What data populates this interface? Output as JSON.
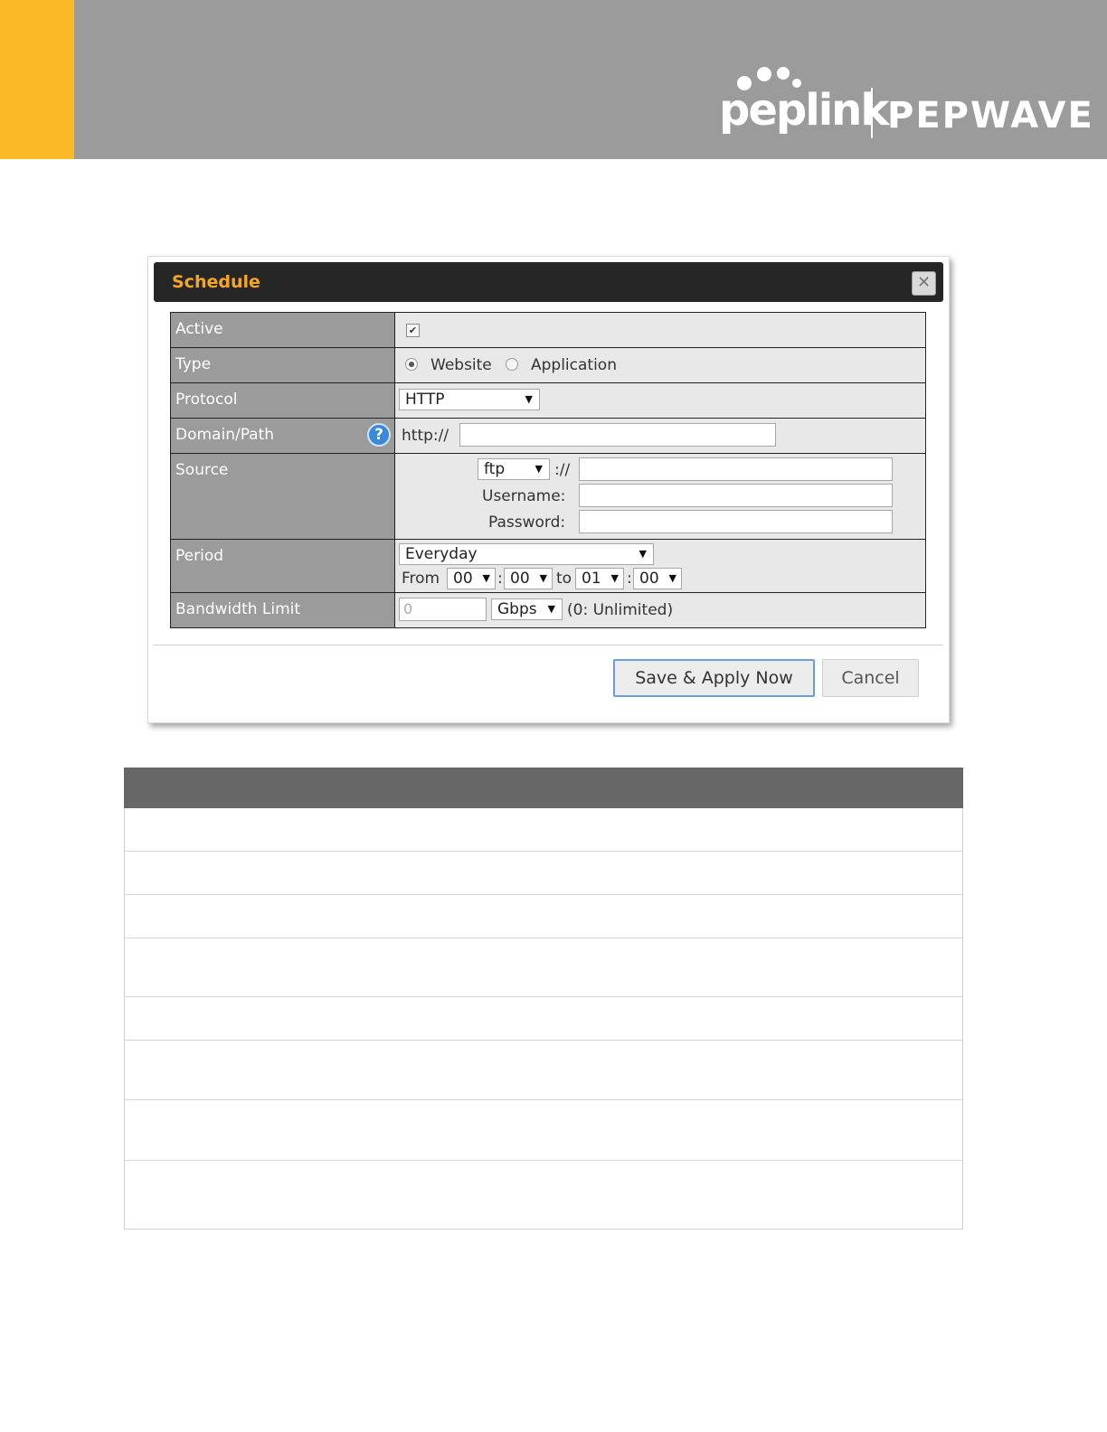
{
  "brand": {
    "logo_left": "peplink",
    "logo_right": "PEPWAVE",
    "accent_color": "#fdb827",
    "header_color": "#9b9b9b"
  },
  "dialog": {
    "title": "Schedule",
    "close_icon": "close-icon",
    "fields": {
      "active": {
        "label": "Active",
        "checked": true
      },
      "type": {
        "label": "Type",
        "options": [
          "Website",
          "Application"
        ],
        "selected": "Website"
      },
      "protocol": {
        "label": "Protocol",
        "value": "HTTP"
      },
      "domain": {
        "label": "Domain/Path",
        "prefix": "http://",
        "value": ""
      },
      "source": {
        "label": "Source",
        "scheme": "ftp",
        "separator": "://",
        "url_value": "",
        "username_label": "Username:",
        "username_value": "",
        "password_label": "Password:",
        "password_value": ""
      },
      "period": {
        "label": "Period",
        "value": "Everyday",
        "from_label": "From",
        "from_hour": "00",
        "from_minute": "00",
        "colon": ":",
        "to_label": "to",
        "to_hour": "01",
        "to_minute": "00"
      },
      "bandwidth": {
        "label": "Bandwidth Limit",
        "placeholder": "0",
        "unit": "Gbps",
        "hint": "(0: Unlimited)"
      }
    },
    "buttons": {
      "save": "Save & Apply Now",
      "cancel": "Cancel"
    }
  },
  "bottom_table": {
    "header": "",
    "rows": 8
  }
}
